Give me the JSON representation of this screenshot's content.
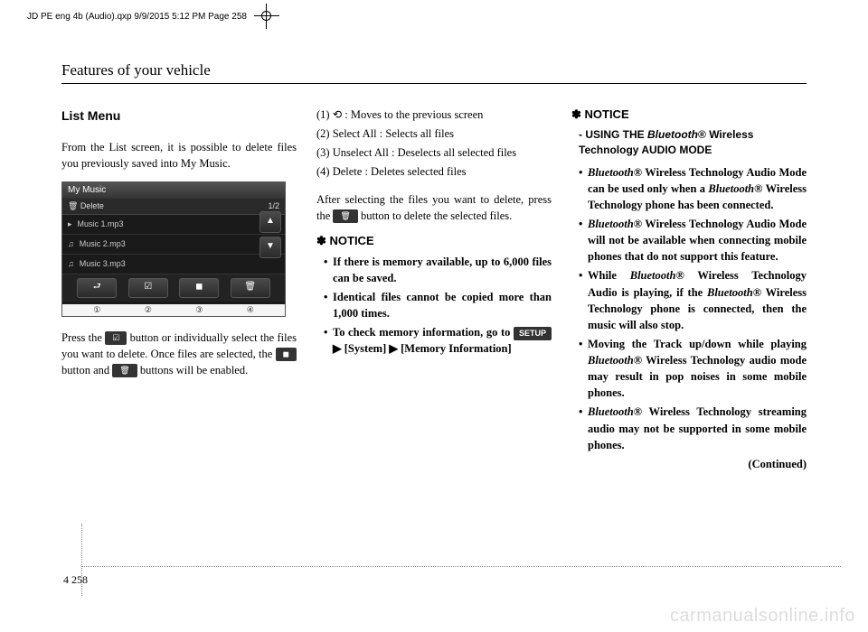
{
  "meta": {
    "file_info": "JD PE eng 4b (Audio).qxp  9/9/2015  5:12 PM  Page 258"
  },
  "section_title": "Features of your vehicle",
  "col1": {
    "heading": "List Menu",
    "intro": "From the List screen, it is possible to delete files you previously saved into My Music.",
    "screen": {
      "title": "My Music",
      "subtitle_left": "🗑 Delete",
      "subtitle_right": "1/2",
      "rows": [
        "Music 1.mp3",
        "Music 2.mp3",
        "Music 3.mp3"
      ],
      "labels": [
        "①",
        "②",
        "③",
        "④"
      ]
    },
    "para2_a": "Press the ",
    "para2_b": " button or individually select the files you want to delete. Once files are selected, the ",
    "para2_c": " button and ",
    "para2_d": " buttons will be enabled.",
    "btn_selectall": "☑",
    "btn_stop": "◼",
    "btn_trash": "🗑"
  },
  "col2": {
    "items": [
      "(1) ⟲  : Moves to the previous screen",
      "(2) Select All : Selects all files",
      "(3) Unselect All : Deselects all selected files",
      "(4) Delete : Deletes selected files"
    ],
    "after_a": "After selecting the files you want to delete, press the ",
    "after_b": " button to delete the selected files.",
    "btn_trash": "🗑",
    "notice_head": "✽ NOTICE",
    "bullets": [
      "If there is memory available, up to 6,000 files can be saved.",
      "Identical files cannot be copied more than 1,000 times."
    ],
    "bullet3_a": "To check memory information, go to ",
    "bullet3_b": " ▶ [System] ▶ [Memory Information]",
    "btn_setup": "SETUP"
  },
  "col3": {
    "notice_head": "✽ NOTICE",
    "notice_sub_dash": "-",
    "notice_sub_a": "USING THE ",
    "notice_sub_b": "Bluetooth",
    "notice_sub_c": "®",
    "notice_sub_d": " Wireless Technology AUDIO MODE",
    "b1_a": "Bluetooth",
    "b1_b": "® Wireless Technology Audio Mode can be used only when a ",
    "b1_c": "Bluetooth",
    "b1_d": "® Wireless Technology phone has been connected.",
    "b2_a": "Bluetooth",
    "b2_b": "® Wireless Technology Audio Mode will not be available when connecting mobile phones that do not support this feature.",
    "b3_a": "While ",
    "b3_b": "Bluetooth",
    "b3_c": "® Wireless Technology Audio is playing, if the ",
    "b3_d": "Bluetooth",
    "b3_e": "® Wireless Technology phone is connected, then the music will also stop.",
    "b4_a": "Moving the Track up/down while playing ",
    "b4_b": "Bluetooth",
    "b4_c": "® Wireless Technology audio mode may result in pop noises in some mobile phones.",
    "b5_a": "Bluetooth",
    "b5_b": "® Wireless Technology streaming audio may not be supported in some mobile phones.",
    "continued": "(Continued)"
  },
  "footer": {
    "chapter": "4",
    "page": "258"
  },
  "watermark": "carmanualsonline.info"
}
